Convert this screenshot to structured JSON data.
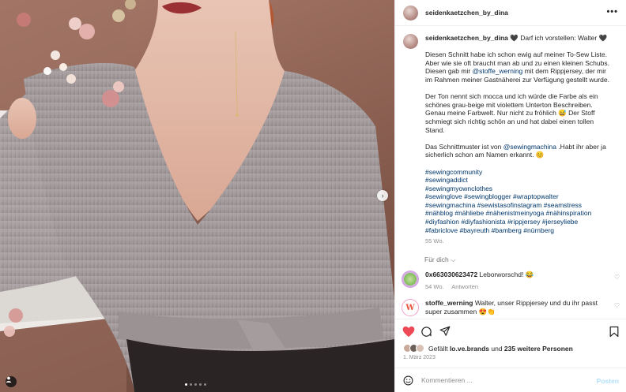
{
  "post": {
    "username": "seidenkaetzchen_by_dina",
    "more_label": "•••"
  },
  "caption": {
    "username": "seidenkaetzchen_by_dina",
    "first_line_rest": "🖤 Darf ich vorstellen: Walter 🖤",
    "p1": [
      "Diesen Schnitt habe ich schon ewig auf meiner To-Sew Liste.",
      "Aber wie sie oft braucht man ab und zu einen kleinen Schubs."
    ],
    "p1_mention_pre": "Diesen gab mir ",
    "p1_mention": "@stoffe_werning",
    "p1_mention_post": " mit dem Rippjersey, der mir",
    "p1_last": "im Rahmen meiner Gastnäherei zur Verfügung gestellt wurde.",
    "p2": [
      "Der Ton nennt sich mocca und ich würde die Farbe als ein",
      "schönes grau-beige mit violettem Unterton Beschreiben.",
      "Genau meine Farbwelt. Nur nicht zu fröhlich 😅 Der Stoff",
      "schmiegt sich richtig schön an und hat dabei einen tollen",
      "Stand."
    ],
    "p3_pre": "Das Schnittmuster ist von ",
    "p3_mention": "@sewingmachina",
    "p3_post": " .Habt ihr aber ja",
    "p3_last": "sicherlich schon am Namen erkannt. 😊",
    "hashtags": [
      "#sewingcommunity",
      "#sewingaddict",
      "#sewingmyownclothes",
      "#sewinglove #sewingblogger #wraptopwalter",
      "#sewingmachina #sewistasofinstagram #seamstress",
      "#nähblog #nähliebe #nähenistmeinyoga #nähinspiration",
      "#diyfashion #diyfashionista #rippjersey #jerseyliebe",
      "#fabriclove #bayreuth #bamberg #nürnberg"
    ],
    "time": "55 Wo."
  },
  "fur_dich": "Für dich ⌵",
  "comments": [
    {
      "username": "0x663030623472",
      "text": " Leborworschd! 😂",
      "time": "54 Wo.",
      "reply": "Antworten"
    },
    {
      "username": "stoffe_werning",
      "text": " Walter, unser Rippjersey und du ihr passt",
      "text2": "super zusammen 😍👏"
    }
  ],
  "likes": {
    "prefix": "Gefällt ",
    "user": "lo.ve.brands",
    "mid": " und ",
    "others": "235 weitere Personen"
  },
  "date": "1. März 2023",
  "comment_input": {
    "placeholder": "Kommentieren ..."
  },
  "post_button": "Posten",
  "colors": {
    "like_red": "#ed4956",
    "link_blue": "#00376b",
    "post_button": "#b2dffc"
  },
  "icons": [
    "heart-icon",
    "comment-icon",
    "share-icon",
    "bookmark-icon",
    "emoji-icon",
    "chevron-right-icon",
    "user-tag-icon",
    "more-icon"
  ]
}
